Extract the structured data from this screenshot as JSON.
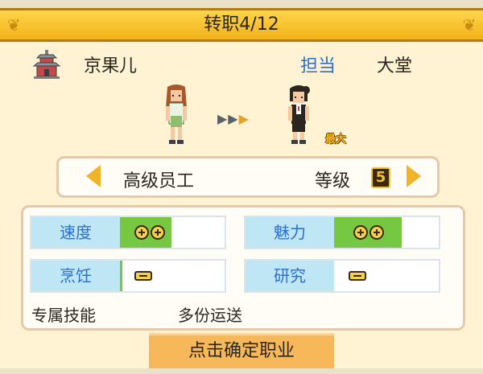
{
  "header": {
    "title": "转职4/12"
  },
  "character": {
    "name": "京果儿",
    "role_label": "担当",
    "place": "大堂",
    "max_badge": "最大"
  },
  "job": {
    "name": "高级员工",
    "level_label": "等级",
    "level": "5"
  },
  "stats": [
    {
      "label": "速度",
      "pluses": 2,
      "bar_fill": 0.5
    },
    {
      "label": "魅力",
      "pluses": 2,
      "bar_fill": 0.5
    },
    {
      "label": "烹饪",
      "pluses": 0,
      "bar_fill": 0.0
    },
    {
      "label": "研究",
      "pluses": 0,
      "bar_fill": 0.0
    }
  ],
  "skill": {
    "label": "专属技能",
    "value": "多份运送"
  },
  "confirm_button": "点击确定职业",
  "colors": {
    "accent_blue": "#2a6fd0",
    "bar_green": "#76c742",
    "header_gold": "#f2b21a"
  },
  "icons": [
    "pagoda-icon",
    "left-arrow-icon",
    "right-arrow-icon",
    "plus-icon",
    "minus-icon"
  ]
}
